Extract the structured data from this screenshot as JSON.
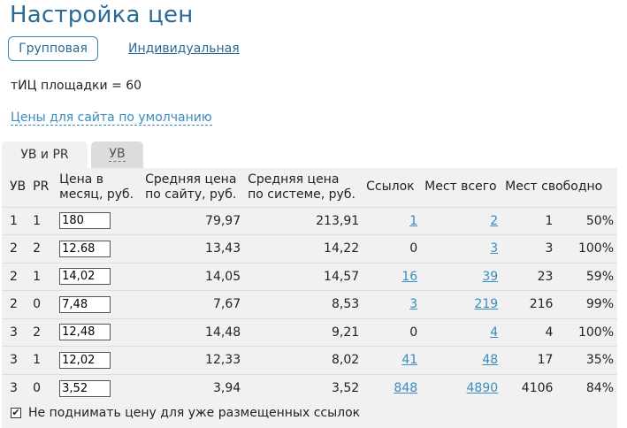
{
  "page": {
    "title": "Настройка цен",
    "mode_group": "Групповая",
    "mode_individual": "Индивидуальная",
    "tic_text": "тИЦ площадки = 60",
    "defaults_link": "Цены для сайта по умолчанию"
  },
  "tabs": [
    {
      "label": "УВ и PR",
      "active": true
    },
    {
      "label": "УВ",
      "active": false
    }
  ],
  "table": {
    "headers": {
      "uv": "УВ",
      "pr": "PR",
      "price_line1": "Цена в",
      "price_line2": "месяц, руб.",
      "avg_site_line1": "Средняя цена",
      "avg_site_line2": "по сайту, руб.",
      "avg_sys_line1": "Средняя цена",
      "avg_sys_line2": "по системе, руб.",
      "links": "Ссылок",
      "places_total": "Мест всего",
      "places_free": "Мест свободно"
    },
    "rows": [
      {
        "uv": "1",
        "pr": "1",
        "price": "180",
        "avg_site": "79,97",
        "avg_sys": "213,91",
        "links": "1",
        "links_is_link": true,
        "total": "2",
        "free": "1",
        "pct": "50%"
      },
      {
        "uv": "2",
        "pr": "2",
        "price": "12.68",
        "avg_site": "13,43",
        "avg_sys": "14,22",
        "links": "0",
        "links_is_link": false,
        "total": "3",
        "free": "3",
        "pct": "100%"
      },
      {
        "uv": "2",
        "pr": "1",
        "price": "14,02",
        "avg_site": "14,05",
        "avg_sys": "14,57",
        "links": "16",
        "links_is_link": true,
        "total": "39",
        "free": "23",
        "pct": "59%"
      },
      {
        "uv": "2",
        "pr": "0",
        "price": "7,48",
        "avg_site": "7,67",
        "avg_sys": "8,53",
        "links": "3",
        "links_is_link": true,
        "total": "219",
        "free": "216",
        "pct": "99%"
      },
      {
        "uv": "3",
        "pr": "2",
        "price": "12,48",
        "avg_site": "14,48",
        "avg_sys": "9,21",
        "links": "0",
        "links_is_link": false,
        "total": "4",
        "free": "4",
        "pct": "100%"
      },
      {
        "uv": "3",
        "pr": "1",
        "price": "12,02",
        "avg_site": "12,33",
        "avg_sys": "8,02",
        "links": "41",
        "links_is_link": true,
        "total": "48",
        "free": "17",
        "pct": "35%"
      },
      {
        "uv": "3",
        "pr": "0",
        "price": "3,52",
        "avg_site": "3,94",
        "avg_sys": "3,52",
        "links": "848",
        "links_is_link": true,
        "total": "4890",
        "free": "4106",
        "pct": "84%"
      }
    ]
  },
  "footer": {
    "checkbox_checked": true,
    "checkbox_mark": "✔",
    "checkbox_label": "Не поднимать цену для уже размещенных ссылок"
  },
  "colors": {
    "title": "#2b6a95",
    "link": "#3a8cc0",
    "panel": "#f1f1f1",
    "inactive_tab": "#dcdcdc"
  }
}
